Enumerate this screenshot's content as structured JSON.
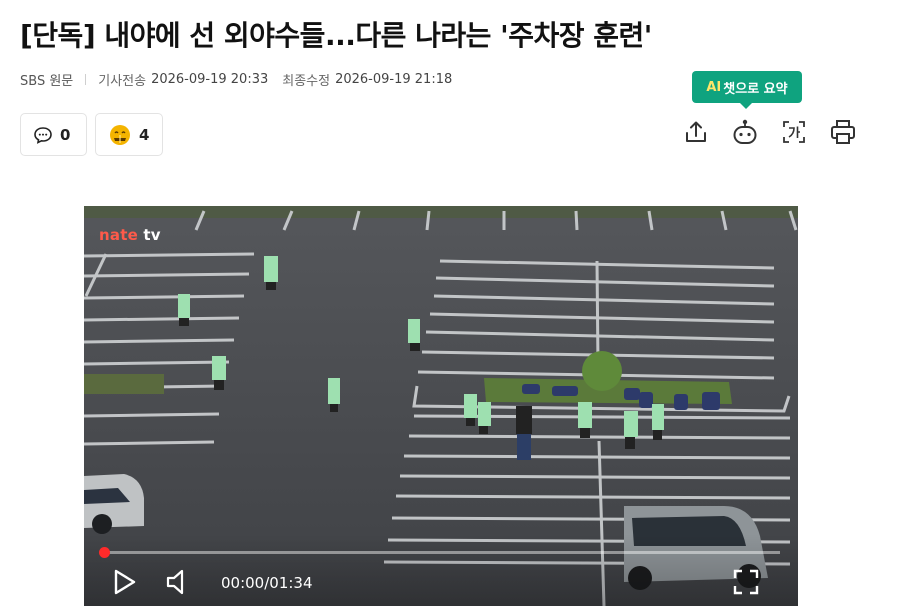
{
  "article": {
    "headline": "[단독] 내야에 선 외야수들...다른 나라는 '주차장 훈련'",
    "press": "SBS 원문",
    "published_label": "기사전송",
    "published_value": "2026-09-19 20:33",
    "modified_label": "최종수정",
    "modified_value": "2026-09-19 21:18"
  },
  "reactions": {
    "comment_count": "0",
    "emotion_count": "4"
  },
  "ai_summary_badge": {
    "ai": "AI",
    "text": "챗으로 요약"
  },
  "toolbar": {
    "icons": [
      "share-icon",
      "chatbot-icon",
      "translate-icon",
      "print-icon"
    ]
  },
  "video": {
    "brand_main": "nate",
    "brand_tv": "tv",
    "time_display": "00:00/01:34",
    "progress_fraction": 0.0
  },
  "colors": {
    "accent_green": "#0fa37f",
    "brand_red": "#ff5a4a",
    "progress_red": "#ff3a30"
  }
}
